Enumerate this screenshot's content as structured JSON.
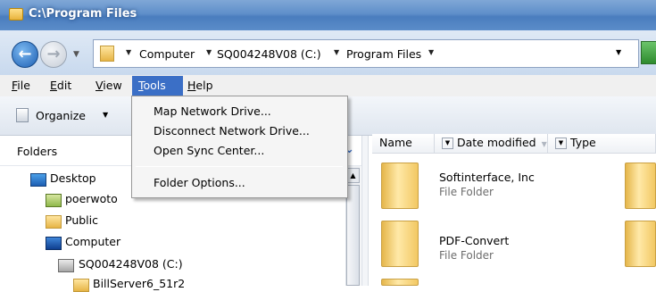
{
  "window": {
    "title": "C:\\Program Files"
  },
  "address": {
    "crumbs": [
      "Computer",
      "SQ004248V08 (C:)",
      "Program Files"
    ]
  },
  "menubar": {
    "items": [
      {
        "label": "File",
        "ul": "F",
        "rest": "ile"
      },
      {
        "label": "Edit",
        "ul": "E",
        "rest": "dit"
      },
      {
        "label": "View",
        "ul": "V",
        "rest": "iew"
      },
      {
        "label": "Tools",
        "ul": "T",
        "rest": "ools"
      },
      {
        "label": "Help",
        "ul": "H",
        "rest": "elp"
      }
    ]
  },
  "toolbar": {
    "organize_label": "Organize"
  },
  "tools_menu": {
    "items": [
      "Map Network Drive...",
      "Disconnect Network Drive...",
      "Open Sync Center...",
      "Folder Options..."
    ]
  },
  "folders_pane": {
    "header": "Folders",
    "tree": [
      "Desktop",
      "poerwoto",
      "Public",
      "Computer",
      "SQ004248V08 (C:)",
      "BillServer6_51r2"
    ]
  },
  "file_list": {
    "columns": [
      "Name",
      "Date modified",
      "Type"
    ],
    "items": [
      {
        "name": "Softinterface, Inc",
        "type": "File Folder"
      },
      {
        "name": "PDF-Convert",
        "type": "File Folder"
      }
    ]
  },
  "colors": {
    "accent": "#3b6fc6",
    "title_bar": "#5f8fca"
  }
}
